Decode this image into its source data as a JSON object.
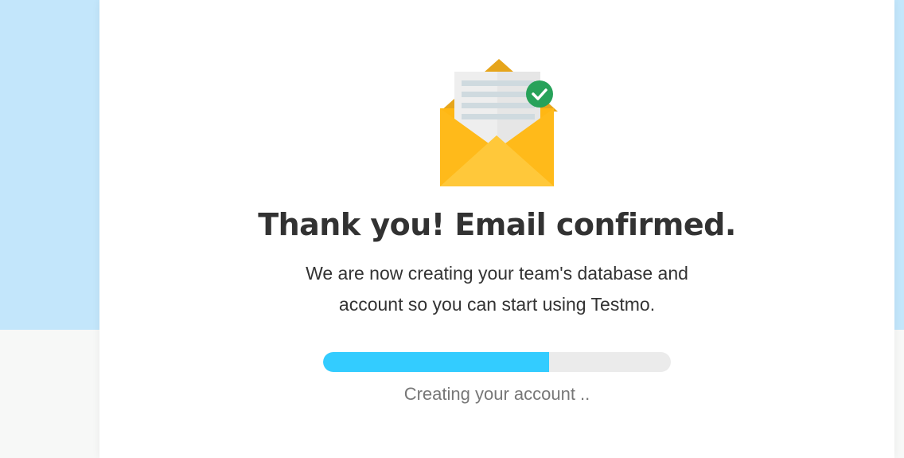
{
  "confirmation": {
    "title": "Thank you! Email confirmed.",
    "message_line1": "We are now creating your team's database and",
    "message_line2": "account so you can start using Testmo.",
    "status_text": "Creating your account ..",
    "progress_fraction": 0.65,
    "progress_color": "#33ccff",
    "illustration_icon": "open-envelope-with-check-icon"
  },
  "colors": {
    "background_top": "#c3e6fb",
    "background_bottom": "#f7f8f7",
    "card": "#ffffff",
    "title_text": "#323232",
    "envelope_yellow": "#ffc83a",
    "check_badge": "#27a25a"
  }
}
